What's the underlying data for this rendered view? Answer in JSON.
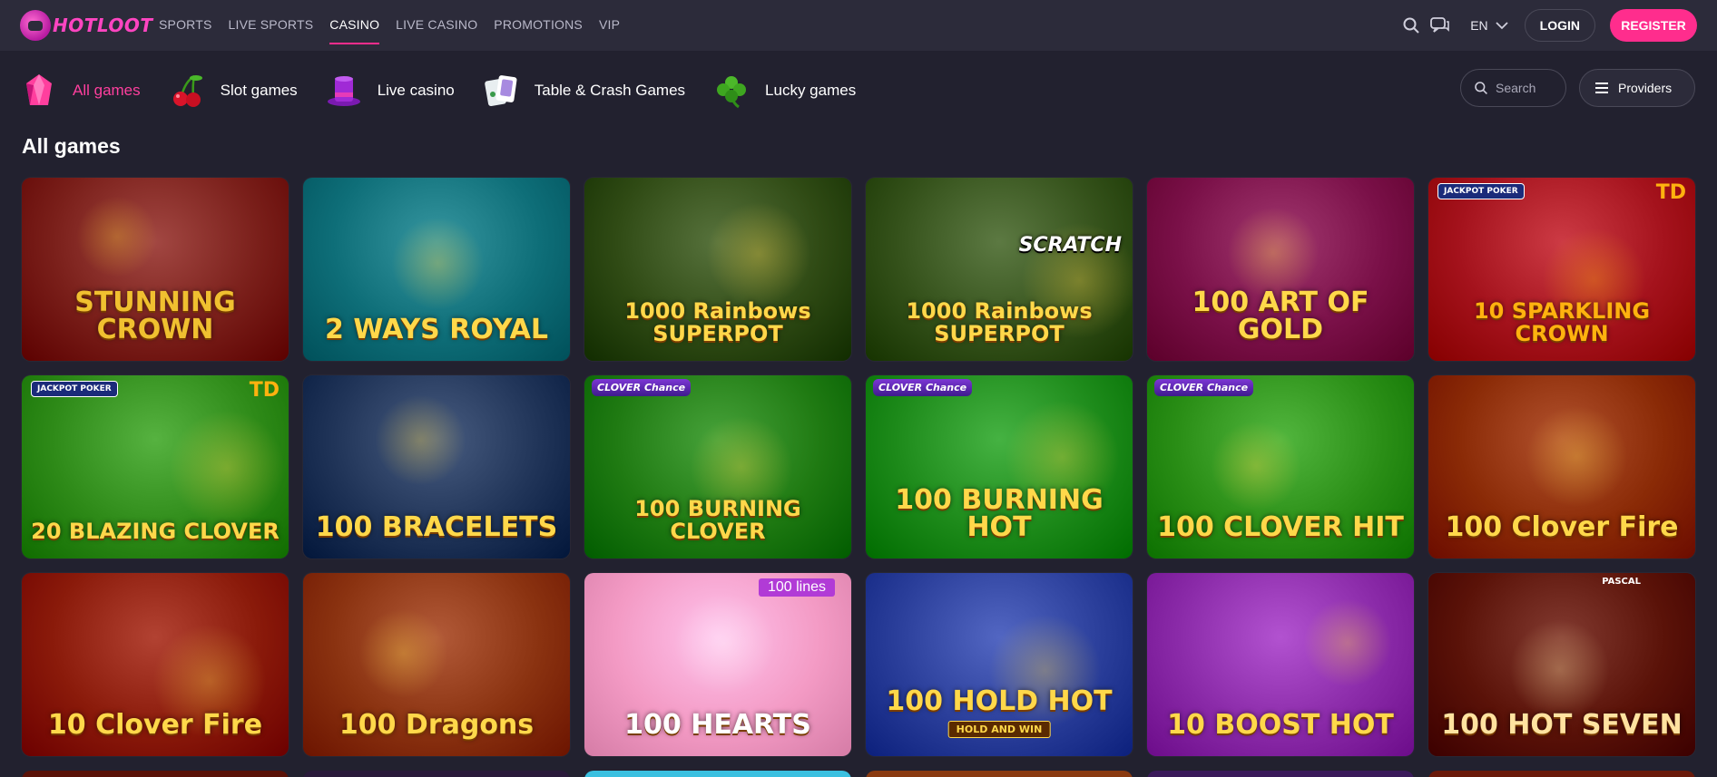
{
  "header": {
    "logo_text": "HOTLOOT",
    "nav": [
      {
        "label": "SPORTS",
        "active": false
      },
      {
        "label": "LIVE SPORTS",
        "active": false
      },
      {
        "label": "CASINO",
        "active": true
      },
      {
        "label": "LIVE CASINO",
        "active": false
      },
      {
        "label": "PROMOTIONS",
        "active": false
      },
      {
        "label": "VIP",
        "active": false
      }
    ],
    "language": "EN",
    "login_label": "LOGIN",
    "register_label": "REGISTER",
    "accent_color": "#ff2d8d"
  },
  "categories": [
    {
      "label": "All games",
      "icon": "gem-icon",
      "active": true
    },
    {
      "label": "Slot games",
      "icon": "cherries-icon",
      "active": false
    },
    {
      "label": "Live casino",
      "icon": "top-hat-icon",
      "active": false
    },
    {
      "label": "Table & Crash Games",
      "icon": "playing-cards-icon",
      "active": false
    },
    {
      "label": "Lucky games",
      "icon": "clover-icon",
      "active": false
    }
  ],
  "search": {
    "placeholder": "Search"
  },
  "providers_label": "Providers",
  "section_title": "All games",
  "games": [
    {
      "title": "STUNNING CROWN",
      "bg": "#7a1f1a",
      "accent": "#f0c030"
    },
    {
      "title": "2 WAYS ROYAL",
      "bg": "#0e6e78",
      "accent": "#ffd84a"
    },
    {
      "title": "1000 Rainbows SUPERPOT",
      "bg": "#2f4a14",
      "accent": "#ffd84a"
    },
    {
      "title": "1000 Rainbows SUPERPOT",
      "bg": "#34511a",
      "accent": "#ffd84a",
      "badge": "SCRATCH"
    },
    {
      "title": "100 ART OF GOLD",
      "bg": "#7a1048",
      "accent": "#ffd84a"
    },
    {
      "title": "10 SPARKLING CROWN",
      "bg": "#a4121c",
      "accent": "#ffb20f",
      "badge": "TD",
      "jackpot": "JACKPOT POKER"
    },
    {
      "title": "20 BLAZING CLOVER",
      "bg": "#2e8a18",
      "accent": "#ffd84a",
      "badge": "TD",
      "jackpot": "JACKPOT POKER"
    },
    {
      "title": "100 BRACELETS",
      "bg": "#203458",
      "accent": "#ffd84a"
    },
    {
      "title": "100 BURNING CLOVER",
      "bg": "#1f7a12",
      "accent": "#ffd84a",
      "clover": "CLOVER Chance"
    },
    {
      "title": "100 BURNING HOT",
      "bg": "#1d8a1a",
      "accent": "#ffd84a",
      "clover": "CLOVER Chance"
    },
    {
      "title": "100 CLOVER HIT",
      "bg": "#2a8e16",
      "accent": "#ffd84a",
      "clover": "CLOVER Chance"
    },
    {
      "title": "100 Clover Fire",
      "bg": "#8a2a06",
      "accent": "#ffd84a"
    },
    {
      "title": "10 Clover Fire",
      "bg": "#8a1a0a",
      "accent": "#ffd84a"
    },
    {
      "title": "100 Dragons",
      "bg": "#8a3210",
      "accent": "#ffd84a"
    },
    {
      "title": "100 HEARTS",
      "bg": "#f39ac4",
      "accent": "#ffffff",
      "lines": "100 lines"
    },
    {
      "title": "100 HOLD HOT",
      "bg": "#2a3e9a",
      "accent": "#ffd84a",
      "hold": "HOLD AND WIN"
    },
    {
      "title": "10 BOOST HOT",
      "bg": "#8a2aa8",
      "accent": "#ffd84a"
    },
    {
      "title": "100 HOT SEVEN",
      "bg": "#5a1208",
      "accent": "#ffe2a0",
      "pascal": "PASCAL"
    }
  ]
}
